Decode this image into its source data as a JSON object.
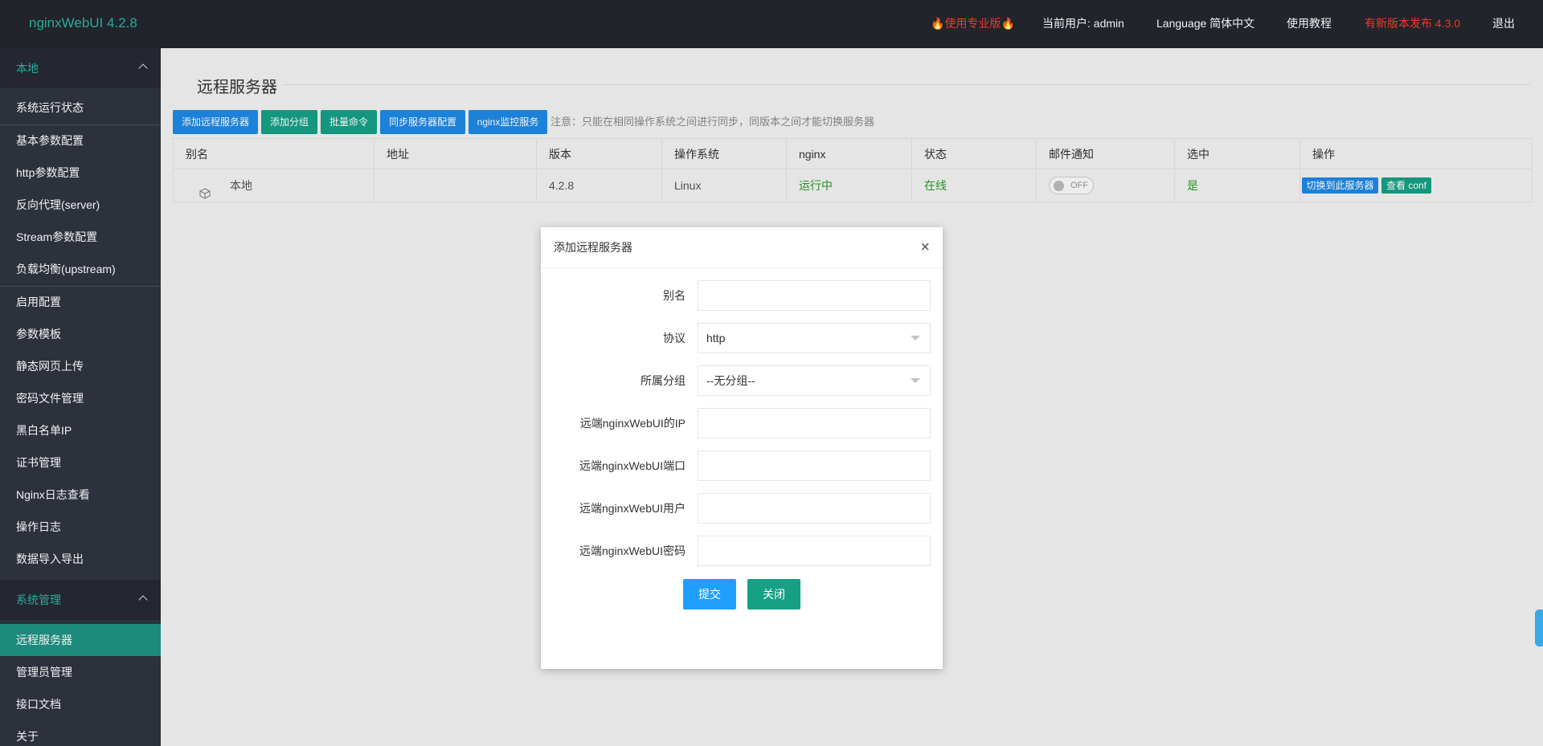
{
  "app": {
    "logo": "nginxWebUI 4.2.8"
  },
  "header": {
    "pro": "使用专业版",
    "user": "当前用户: admin",
    "language": "Language 简体中文",
    "tutorial": "使用教程",
    "new_version": "有新版本发布 4.3.0",
    "logout": "退出"
  },
  "sidebar": {
    "group_local": "本地",
    "items_local": [
      "系统运行状态",
      "基本参数配置",
      "http参数配置",
      "反向代理(server)",
      "Stream参数配置",
      "负载均衡(upstream)",
      "启用配置",
      "参数模板",
      "静态网页上传",
      "密码文件管理",
      "黑白名单IP",
      "证书管理",
      "Nginx日志查看",
      "操作日志",
      "数据导入导出"
    ],
    "group_system": "系统管理",
    "items_system": [
      "远程服务器",
      "管理员管理",
      "接口文档",
      "关于"
    ]
  },
  "page": {
    "title": "远程服务器",
    "buttons": [
      "添加远程服务器",
      "添加分组",
      "批量命令",
      "同步服务器配置",
      "nginx监控服务"
    ],
    "note": "注意：只能在相同操作系统之间进行同步，同版本之间才能切换服务器"
  },
  "table": {
    "headers": [
      "别名",
      "地址",
      "版本",
      "操作系统",
      "nginx",
      "状态",
      "邮件通知",
      "选中",
      "操作"
    ],
    "row": {
      "alias": "本地",
      "address": "",
      "version": "4.2.8",
      "os": "Linux",
      "nginx": "运行中",
      "status": "在线",
      "email": "OFF",
      "selected": "是",
      "op_switch": "切换到此服务器",
      "op_conf": "查看 conf"
    }
  },
  "modal": {
    "title": "添加远程服务器",
    "close": "×",
    "fields": {
      "alias": {
        "label": "别名",
        "value": ""
      },
      "protocol": {
        "label": "协议",
        "value": "http"
      },
      "group": {
        "label": "所属分组",
        "value": "--无分组--"
      },
      "ip": {
        "label": "远端nginxWebUI的IP",
        "value": ""
      },
      "port": {
        "label": "远端nginxWebUI端口",
        "value": ""
      },
      "user": {
        "label": "远端nginxWebUI用户",
        "value": ""
      },
      "pass": {
        "label": "远端nginxWebUI密码",
        "value": ""
      }
    },
    "submit": "提交",
    "cancel": "关闭"
  },
  "colors": {
    "header_bg": "#23262e",
    "sidebar_bg": "#2f3440",
    "accent_teal": "#1e9383",
    "primary_blue": "#1e9fff",
    "btn_blue": "#1e88e5",
    "btn_teal": "#16a085",
    "alert_red": "#ff3b30"
  }
}
